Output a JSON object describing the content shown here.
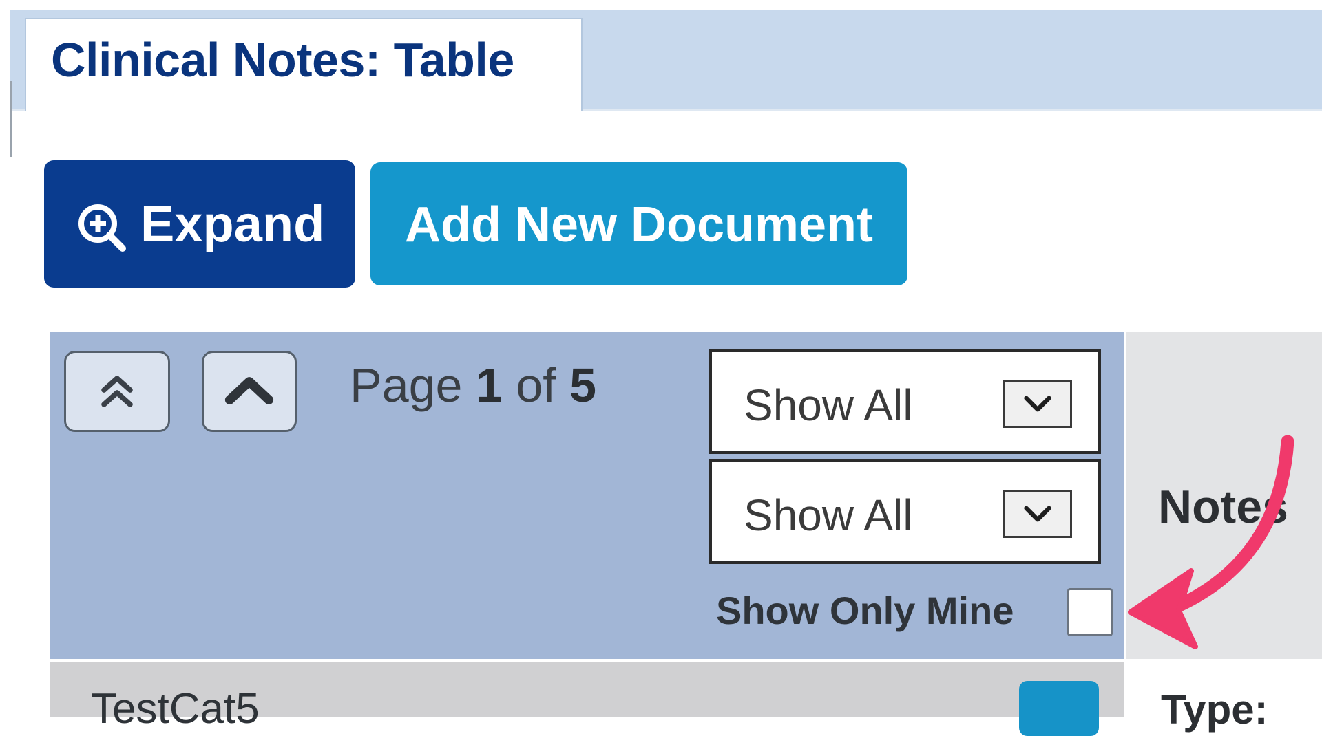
{
  "tab": {
    "title": "Clinical Notes: Table"
  },
  "toolbar": {
    "expand_label": "Expand",
    "add_label": "Add New Document"
  },
  "pager": {
    "prefix": "Page",
    "current": "1",
    "of_text": "of",
    "total": "5"
  },
  "filters": {
    "select1_value": "Show All",
    "select2_value": "Show All",
    "only_mine_label": "Show Only Mine",
    "only_mine_checked": false
  },
  "columns": {
    "notes_header": "Notes"
  },
  "rows": [
    {
      "category": "TestCat5",
      "type_label": "Type:"
    }
  ],
  "colors": {
    "tab_strip": "#c8d9ed",
    "title_text": "#0a347d",
    "expand_button": "#0a3c8f",
    "add_button": "#1597cc",
    "grid_header": "#a2b6d6",
    "annotation_arrow": "#f0396b"
  },
  "icons": {
    "expand": "zoom-in-icon",
    "first_page": "double-chevron-up-icon",
    "prev_page": "chevron-up-icon",
    "dropdown": "chevron-down-icon",
    "annotation": "curved-arrow-icon"
  }
}
